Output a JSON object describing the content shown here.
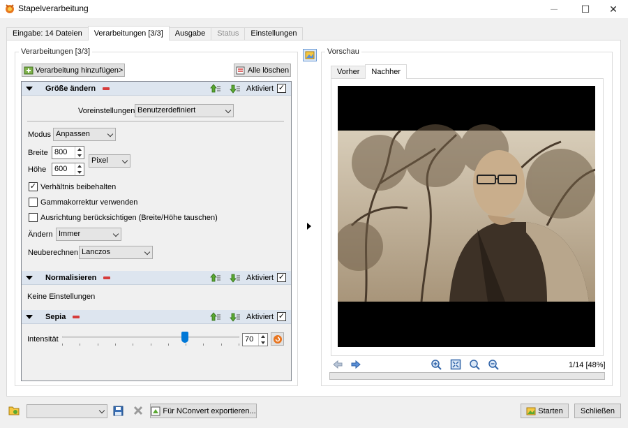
{
  "window": {
    "title": "Stapelverarbeitung",
    "minimize": "—",
    "maximize": "☐",
    "close": "✕"
  },
  "tabs": [
    {
      "label": "Eingabe: 14 Dateien"
    },
    {
      "label": "Verarbeitungen [3/3]"
    },
    {
      "label": "Ausgabe"
    },
    {
      "label": "Status"
    },
    {
      "label": "Einstellungen"
    }
  ],
  "processing": {
    "group_title": "Verarbeitungen [3/3]",
    "add_button": "Verarbeitung hinzufügen>",
    "clear_all_button": "Alle löschen",
    "active_label": "Aktiviert",
    "sections": {
      "resize": {
        "name": "Größe ändern",
        "presets_label": "Voreinstellungen",
        "presets_value": "Benutzerdefiniert",
        "mode_label": "Modus",
        "mode_value": "Anpassen",
        "width_label": "Breite",
        "width_value": "800",
        "height_label": "Höhe",
        "height_value": "600",
        "unit_value": "Pixel",
        "keep_ratio_label": "Verhältnis beibehalten",
        "keep_ratio_checked": true,
        "gamma_label": "Gammakorrektur verwenden",
        "gamma_checked": false,
        "orientation_label": "Ausrichtung berücksichtigen (Breite/Höhe tauschen)",
        "orientation_checked": false,
        "change_label": "Ändern",
        "change_value": "Immer",
        "resample_label": "Neuberechnen",
        "resample_value": "Lanczos"
      },
      "normalize": {
        "name": "Normalisieren",
        "no_settings": "Keine Einstellungen"
      },
      "sepia": {
        "name": "Sepia",
        "intensity_label": "Intensität",
        "intensity_value": "70",
        "intensity_fraction": 0.7
      }
    }
  },
  "preview": {
    "group_title": "Vorschau",
    "tabs": [
      {
        "label": "Vorher"
      },
      {
        "label": "Nachher"
      }
    ],
    "status": "1/14 [48%]"
  },
  "bottom": {
    "export_button": "Für NConvert exportieren...",
    "start_button": "Starten",
    "close_button": "Schließen"
  },
  "colors": {
    "accent": "#0078d7",
    "section_header": "#dde5ef",
    "sepia_reset": "#e8741e"
  }
}
